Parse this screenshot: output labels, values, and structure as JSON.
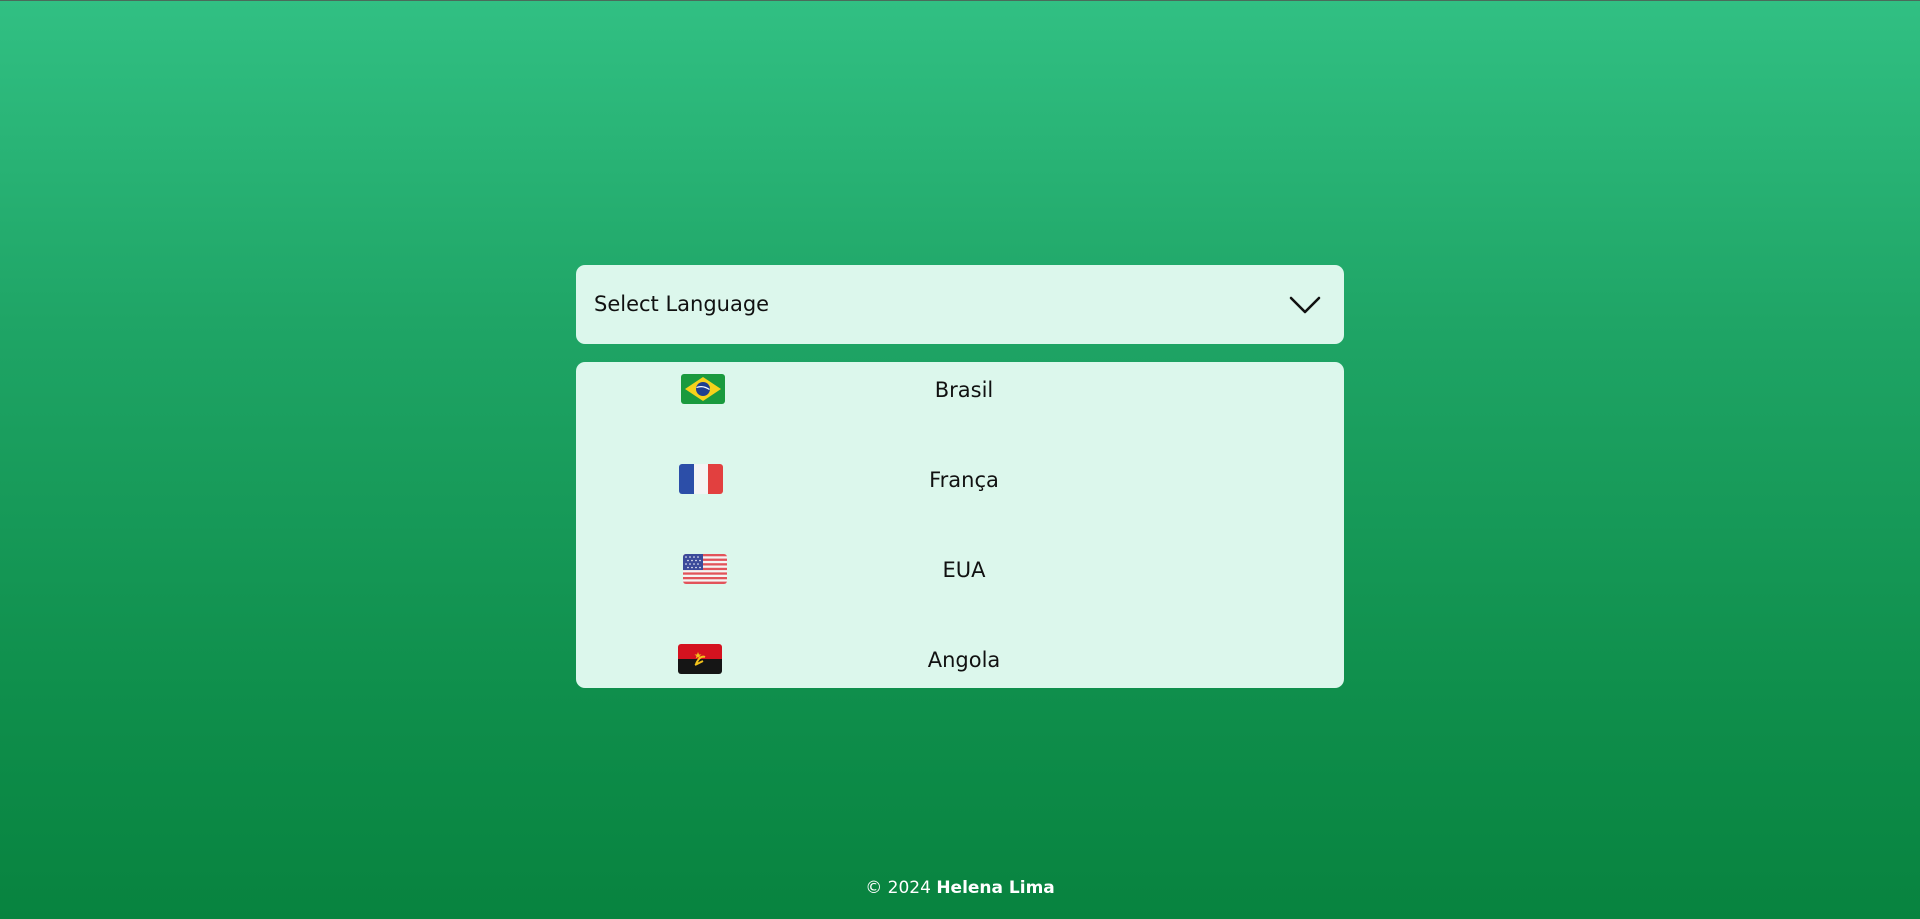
{
  "select": {
    "placeholder": "Select Language",
    "icon": "chevron-down-icon"
  },
  "options": [
    {
      "label": "Brasil",
      "flag": "brazil-flag-icon"
    },
    {
      "label": "França",
      "flag": "france-flag-icon"
    },
    {
      "label": "EUA",
      "flag": "usa-flag-icon"
    },
    {
      "label": "Angola",
      "flag": "angola-flag-icon"
    }
  ],
  "footer": {
    "copyright": "© 2024",
    "author": "Helena Lima"
  },
  "colors": {
    "background_top": "#31c083",
    "background_bottom": "#08833f",
    "panel": "#dcf7ec"
  }
}
